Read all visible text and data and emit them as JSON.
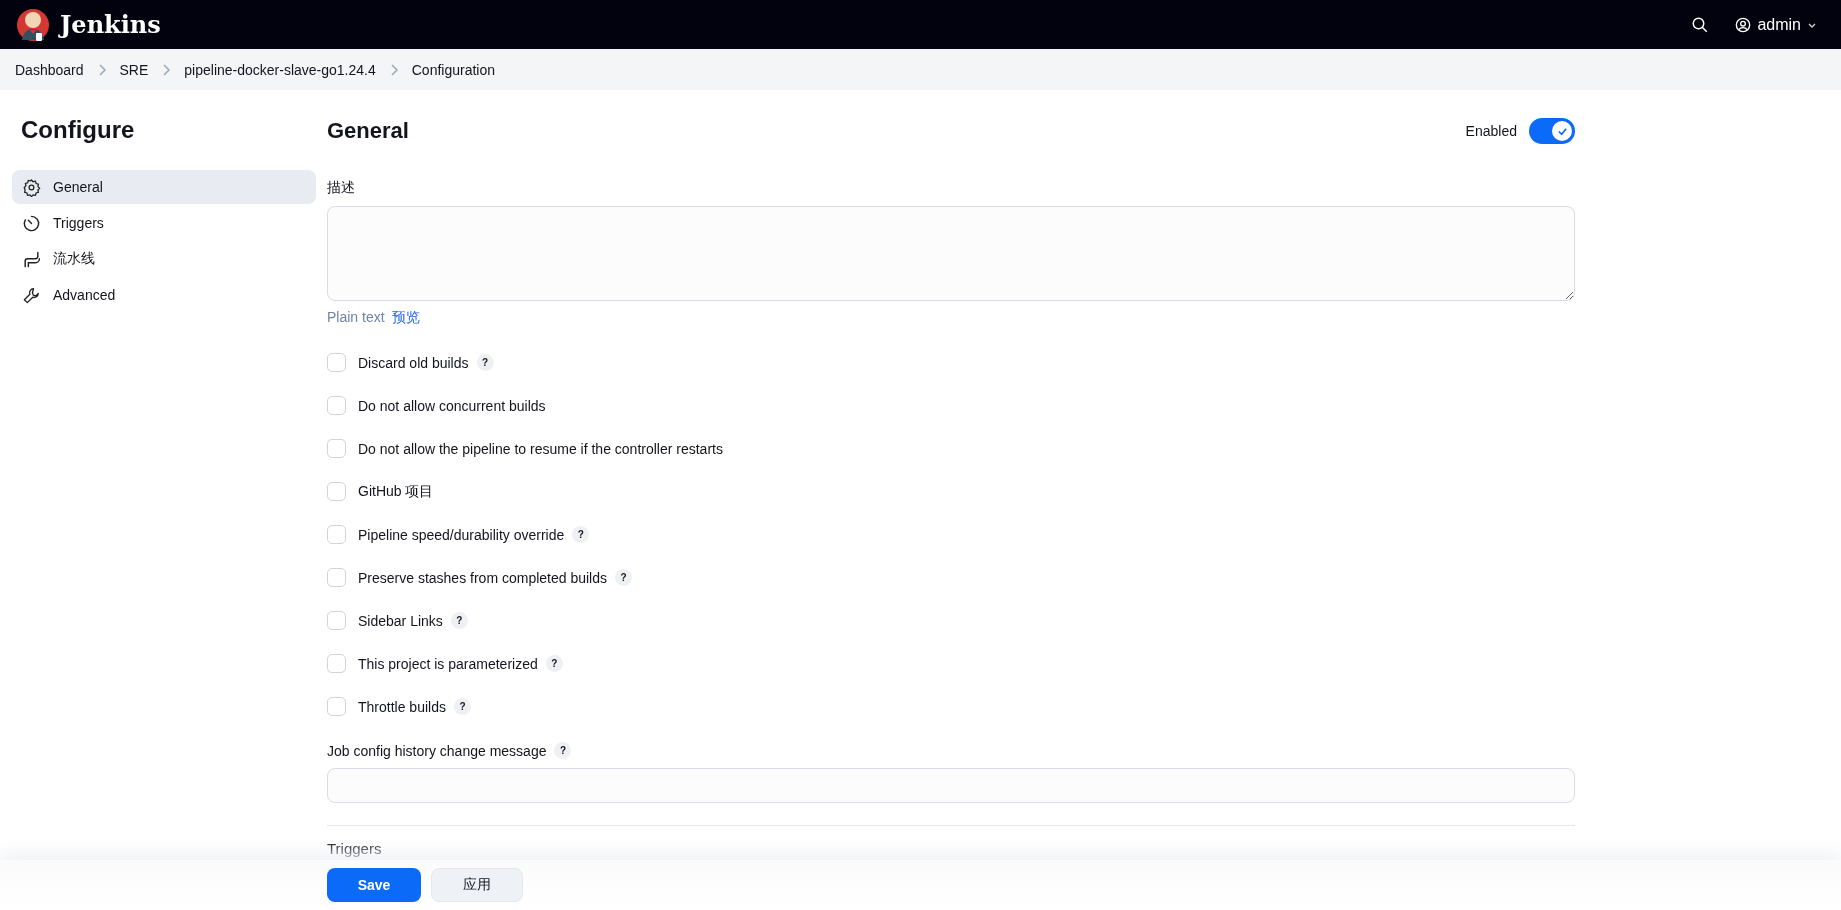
{
  "header": {
    "brand": "Jenkins",
    "user": "admin"
  },
  "breadcrumbs": [
    "Dashboard",
    "SRE",
    "pipeline-docker-slave-go1.24.4",
    "Configuration"
  ],
  "sidebar": {
    "title": "Configure",
    "items": [
      {
        "label": "General",
        "selected": true
      },
      {
        "label": "Triggers",
        "selected": false
      },
      {
        "label": "流水线",
        "selected": false
      },
      {
        "label": "Advanced",
        "selected": false
      }
    ]
  },
  "section": {
    "title": "General",
    "enabled_label": "Enabled",
    "enabled": true
  },
  "description": {
    "label": "描述",
    "value_mode": "Plain text",
    "preview": "预览"
  },
  "options": [
    {
      "label": "Discard old builds",
      "checked": false,
      "help": "?"
    },
    {
      "label": "Do not allow concurrent builds",
      "checked": false
    },
    {
      "label": "Do not allow the pipeline to resume if the controller restarts",
      "checked": false
    },
    {
      "label": "GitHub 项目",
      "checked": false
    },
    {
      "label": "Pipeline speed/durability override",
      "checked": false,
      "help": "?"
    },
    {
      "label": "Preserve stashes from completed builds",
      "checked": false,
      "help": "?"
    },
    {
      "label": "Sidebar Links",
      "checked": false,
      "help": "?"
    },
    {
      "label": "This project is parameterized",
      "checked": false,
      "help": "?"
    },
    {
      "label": "Throttle builds",
      "checked": false,
      "help": "?"
    }
  ],
  "history_message": {
    "label": "Job config history change message",
    "help": "?"
  },
  "next_section": "Triggers",
  "buttons": [
    {
      "label": "Save",
      "kind": "primary"
    },
    {
      "label": "应用",
      "kind": "secondary"
    }
  ]
}
